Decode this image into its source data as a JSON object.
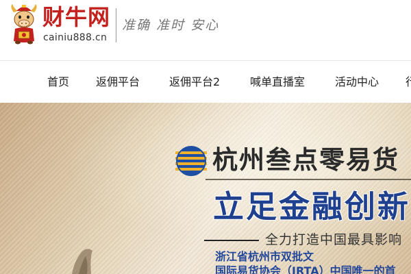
{
  "header": {
    "brand_name": "财牛网",
    "brand_url": "cainiu888.cn",
    "slogan": "准确 准时 安心",
    "logo_icon": "bull-mascot-icon",
    "colors": {
      "brand_red": "#c3211e"
    }
  },
  "nav": {
    "items": [
      {
        "label": "首页"
      },
      {
        "label": "返佣平台"
      },
      {
        "label": "返佣平台2"
      },
      {
        "label": "喊单直播室"
      },
      {
        "label": "活动中心"
      },
      {
        "label": "行"
      }
    ]
  },
  "banner": {
    "company_name": "杭州叁点零易货",
    "headline": "立足金融创新",
    "subtitle": "全力打造中国最具影响",
    "desc_line1": "浙江省杭州市双批文",
    "desc_line2": "国际易货协会（IRTA）中国唯一的首",
    "company_logo_icon": "striped-globe-logo-icon",
    "colors": {
      "headline_blue": "#1f3f8f",
      "desc_blue": "#23479a"
    }
  }
}
